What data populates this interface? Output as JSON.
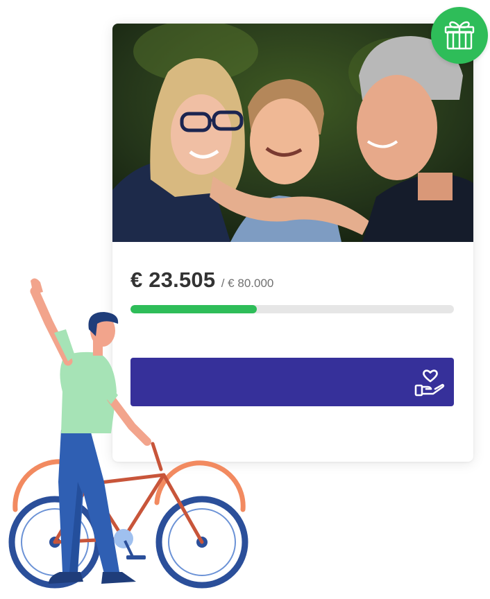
{
  "campaign": {
    "photo_alt": "",
    "raised": "€ 23.505",
    "goal": "/ € 80.000",
    "progress": 0.39
  },
  "donate": {
    "label": "",
    "icon": "heart-in-hand-icon"
  },
  "badge": {
    "icon": "gift-icon"
  },
  "colors": {
    "accent_green": "#2ebd59",
    "button": "#36309a",
    "text_dark": "#333333",
    "text_muted": "#707070",
    "track": "#e6e6e6"
  }
}
